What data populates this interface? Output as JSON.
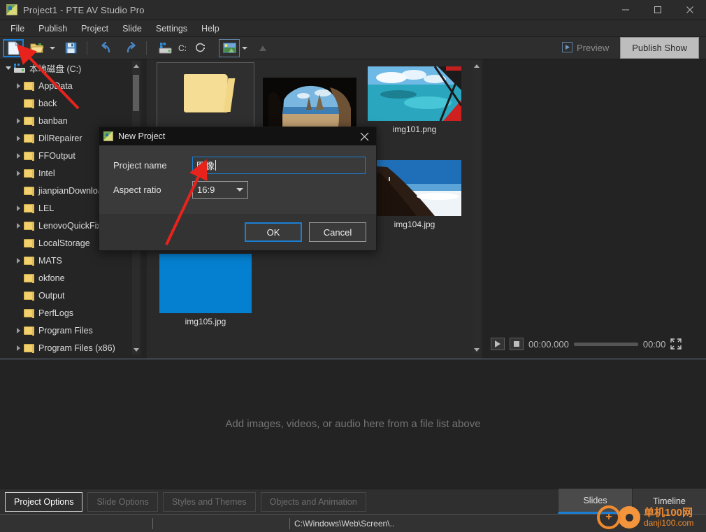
{
  "window": {
    "title": "Project1 - PTE AV Studio Pro",
    "app_icon": "app-logo-icon",
    "minimize": "—",
    "maximize": "□",
    "close": "✕"
  },
  "menu": {
    "items": [
      {
        "label": "File"
      },
      {
        "label": "Publish"
      },
      {
        "label": "Project"
      },
      {
        "label": "Slide"
      },
      {
        "label": "Settings"
      },
      {
        "label": "Help"
      }
    ]
  },
  "toolbar": {
    "new_project": "new-file-icon",
    "open_project": "open-folder-icon",
    "open_dropdown": "chevron-down-icon",
    "save_project": "save-disk-icon",
    "undo": "undo-arrow-icon",
    "redo": "redo-arrow-icon",
    "drive_icon": "drive-icon",
    "drive_label": "C:",
    "refresh_icon": "refresh-icon",
    "media_filter_icon": "image-filter-icon",
    "media_filter_dropdown": "chevron-down-icon",
    "up_folder_icon": "up-arrow-icon",
    "preview_label": "Preview",
    "preview_icon": "preview-play-icon",
    "publish_label": "Publish Show"
  },
  "tree": {
    "root": {
      "label": "本地磁盘 (C:)",
      "expanded": true,
      "icon": "drive-icon"
    },
    "items": [
      {
        "label": "AppData",
        "expandable": true
      },
      {
        "label": "back",
        "expandable": false
      },
      {
        "label": "banban",
        "expandable": true
      },
      {
        "label": "DllRepairer",
        "expandable": true
      },
      {
        "label": "FFOutput",
        "expandable": true
      },
      {
        "label": "Intel",
        "expandable": true
      },
      {
        "label": "jianpianDownloa",
        "expandable": false
      },
      {
        "label": "LEL",
        "expandable": true
      },
      {
        "label": "LenovoQuickFix",
        "expandable": true
      },
      {
        "label": "LocalStorage",
        "expandable": false
      },
      {
        "label": "MATS",
        "expandable": true
      },
      {
        "label": "okfone",
        "expandable": false
      },
      {
        "label": "Output",
        "expandable": false
      },
      {
        "label": "PerfLogs",
        "expandable": false
      },
      {
        "label": "Program Files",
        "expandable": true
      },
      {
        "label": "Program Files (x86)",
        "expandable": true
      }
    ]
  },
  "files": {
    "items": [
      {
        "label": "",
        "type": "folder",
        "selected": true
      },
      {
        "label": "",
        "type": "image-cave"
      },
      {
        "label": "img101.png",
        "type": "image-lagoon"
      },
      {
        "label": "img104.jpg",
        "type": "image-mountain"
      },
      {
        "label": "img105.jpg",
        "type": "image-blue"
      }
    ]
  },
  "player": {
    "play_icon": "play-icon",
    "stop_icon": "stop-icon",
    "current_time": "00:00.000",
    "total_time": "00:00",
    "fullscreen_icon": "fullscreen-icon"
  },
  "dropzone": {
    "text": "Add images, videos, or audio here from a file list above"
  },
  "bottom": {
    "buttons": [
      {
        "label": "Project Options",
        "state": "active"
      },
      {
        "label": "Slide Options",
        "state": "disabled"
      },
      {
        "label": "Styles and Themes",
        "state": "disabled"
      },
      {
        "label": "Objects and Animation",
        "state": "disabled"
      }
    ],
    "collapse_icon": "collapse-up-icon",
    "tabs": [
      {
        "label": "Slides",
        "selected": true
      },
      {
        "label": "Timeline",
        "selected": false
      }
    ]
  },
  "statusbar": {
    "col1": "",
    "col2": "",
    "path": "C:\\Windows\\Web\\Screen\\.."
  },
  "watermark": {
    "cn": "单机100网",
    "en": "danji100.com"
  },
  "dialog": {
    "title": "New Project",
    "icon": "app-logo-icon",
    "close_icon": "close-icon",
    "project_name_label": "Project name",
    "project_name_value": "图像",
    "aspect_ratio_label": "Aspect ratio",
    "aspect_ratio_value": "16:9",
    "ok_label": "OK",
    "cancel_label": "Cancel"
  },
  "colors": {
    "accent": "#1a7fd4",
    "folder": "#f2d06b",
    "watermark": "#f08a2e",
    "arrow": "#e8231c"
  }
}
